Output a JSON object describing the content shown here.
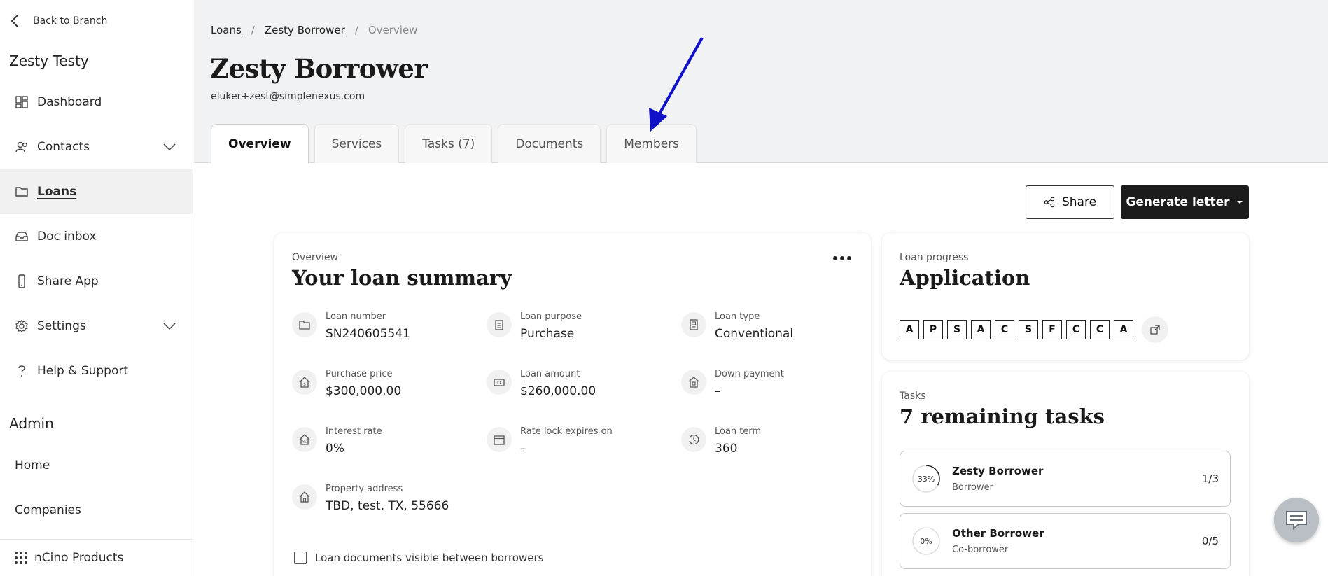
{
  "sidebar": {
    "back_label": "Back to Branch",
    "account_name": "Zesty Testy",
    "items": [
      {
        "label": "Dashboard",
        "icon": "dashboard-icon"
      },
      {
        "label": "Contacts",
        "icon": "contacts-icon"
      },
      {
        "label": "Loans",
        "icon": "folder-icon",
        "active": true
      },
      {
        "label": "Doc inbox",
        "icon": "inbox-icon"
      },
      {
        "label": "Share App",
        "icon": "phone-icon"
      },
      {
        "label": "Settings",
        "icon": "gear-icon"
      },
      {
        "label": "Help & Support",
        "icon": "help-icon"
      }
    ],
    "admin_heading": "Admin",
    "admin_items": [
      "Home",
      "Companies"
    ],
    "ncino_label": "nCino Products"
  },
  "breadcrumb": {
    "items": [
      "Loans",
      "Zesty Borrower"
    ],
    "current": "Overview",
    "separator": "/"
  },
  "header": {
    "title": "Zesty Borrower",
    "email": "eluker+zest@simplenexus.com"
  },
  "tabs": [
    "Overview",
    "Services",
    "Tasks (7)",
    "Documents",
    "Members"
  ],
  "actions": {
    "share_label": "Share",
    "generate_label": "Generate letter"
  },
  "summary": {
    "eyebrow": "Overview",
    "title": "Your loan summary",
    "fields": [
      {
        "label": "Loan number",
        "value": "SN240605541",
        "icon": "folder-icon"
      },
      {
        "label": "Loan purpose",
        "value": "Purchase",
        "icon": "clipboard-icon"
      },
      {
        "label": "Loan type",
        "value": "Conventional",
        "icon": "document-icon"
      },
      {
        "label": "Purchase price",
        "value": "$300,000.00",
        "icon": "house-dollar-icon"
      },
      {
        "label": "Loan amount",
        "value": "$260,000.00",
        "icon": "cash-icon"
      },
      {
        "label": "Down payment",
        "value": "–",
        "icon": "house-building-icon"
      },
      {
        "label": "Interest rate",
        "value": "0%",
        "icon": "house-percent-icon"
      },
      {
        "label": "Rate lock expires on",
        "value": "–",
        "icon": "calendar-icon"
      },
      {
        "label": "Loan term",
        "value": "360",
        "icon": "clock-icon"
      },
      {
        "label": "Property address",
        "value": "TBD, test, TX, 55666",
        "icon": "house-icon"
      }
    ],
    "checkbox_label": "Loan documents visible between borrowers"
  },
  "progress": {
    "eyebrow": "Loan progress",
    "title": "Application",
    "steps": [
      "A",
      "P",
      "S",
      "A",
      "C",
      "S",
      "F",
      "C",
      "C",
      "A"
    ]
  },
  "tasks": {
    "eyebrow": "Tasks",
    "title": "7 remaining tasks",
    "rows": [
      {
        "name": "Zesty Borrower",
        "role": "Borrower",
        "percent_label": "33%",
        "progress": 0.33,
        "count": "1/3"
      },
      {
        "name": "Other Borrower",
        "role": "Co-borrower",
        "percent_label": "0%",
        "progress": 0,
        "count": "0/5"
      }
    ]
  },
  "colors": {
    "annotation_arrow": "#1010c8",
    "primary_button": "#1c1c1c",
    "header_bg": "#f1f2f3"
  }
}
